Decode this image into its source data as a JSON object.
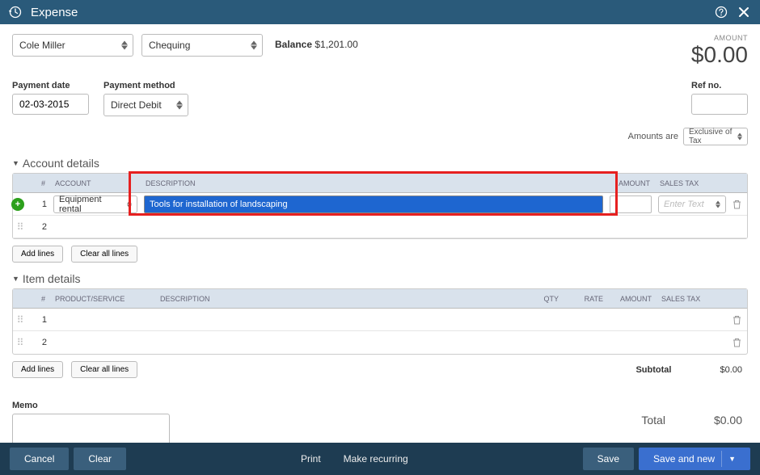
{
  "titlebar": {
    "title": "Expense"
  },
  "payee": "Cole Miller",
  "bank_account": "Chequing",
  "balance_label": "Balance",
  "balance_value": "$1,201.00",
  "amount_label": "AMOUNT",
  "amount_value": "$0.00",
  "labels": {
    "payment_date": "Payment date",
    "payment_method": "Payment method",
    "ref_no": "Ref no.",
    "amounts_are": "Amounts are",
    "memo": "Memo"
  },
  "payment_date": "02-03-2015",
  "payment_method": "Direct Debit",
  "ref_no": "",
  "tax_mode": "Exclusive of Tax",
  "account_section": {
    "title": "Account details",
    "headers": {
      "num": "#",
      "account": "ACCOUNT",
      "description": "DESCRIPTION",
      "amount": "AMOUNT",
      "sales_tax": "SALES TAX"
    },
    "rows": [
      {
        "num": "1",
        "account": "Equipment rental",
        "description": "Tools for installation of landscaping",
        "amount": "",
        "sales_tax_placeholder": "Enter Text"
      },
      {
        "num": "2",
        "account": "",
        "description": "",
        "amount": "",
        "sales_tax_placeholder": ""
      }
    ]
  },
  "item_section": {
    "title": "Item details",
    "headers": {
      "num": "#",
      "product": "PRODUCT/SERVICE",
      "description": "DESCRIPTION",
      "qty": "QTY",
      "rate": "RATE",
      "amount": "AMOUNT",
      "sales_tax": "SALES TAX"
    },
    "rows": [
      {
        "num": "1"
      },
      {
        "num": "2"
      }
    ]
  },
  "buttons": {
    "add_lines": "Add lines",
    "clear_all": "Clear all lines",
    "cancel": "Cancel",
    "clear": "Clear",
    "print": "Print",
    "make_recurring": "Make recurring",
    "save": "Save",
    "save_new": "Save and new"
  },
  "subtotal_label": "Subtotal",
  "subtotal_value": "$0.00",
  "total_label": "Total",
  "total_value": "$0.00"
}
